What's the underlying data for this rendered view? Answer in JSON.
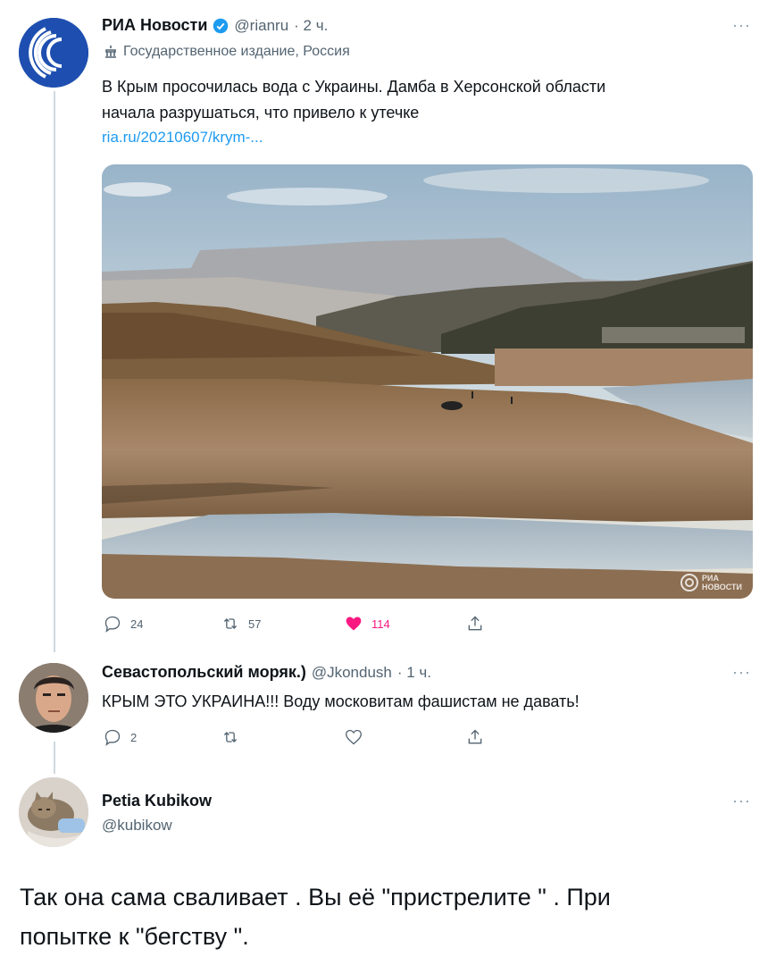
{
  "tweet1": {
    "name": "РИА Новости",
    "handle": "@rianru",
    "time": "· 2 ч.",
    "label": "Государственное издание, Россия",
    "text_line1": "В Крым просочилась вода с Украины. Дамба в Херсонской области",
    "text_line2": "начала разрушаться, что привело к утечке",
    "link": "ria.ru/20210607/krym-...",
    "watermark_top": "РИА",
    "watermark_bottom": "НОВОСТИ",
    "replies": "24",
    "retweets": "57",
    "likes": "114",
    "like_color": "#f91880",
    "more": "···"
  },
  "tweet2": {
    "name": "Севастопольский моряк.)",
    "handle": "@Jkondush",
    "time": "· 1 ч.",
    "text": "КРЫМ ЭТО УКРАИНА!!! Воду московитам фашистам не давать!",
    "replies": "2",
    "more": "···"
  },
  "tweet3": {
    "name": "Petia Kubikow",
    "handle": "@kubikow",
    "more": "···",
    "text_line1": "Так она сама сваливает . Вы её \"пристрелите \" . При",
    "text_line2": "попытке к \"бегству \"."
  },
  "colors": {
    "accent": "#1d9bf0",
    "verified": "#1d9bf0",
    "muted": "#536471"
  }
}
